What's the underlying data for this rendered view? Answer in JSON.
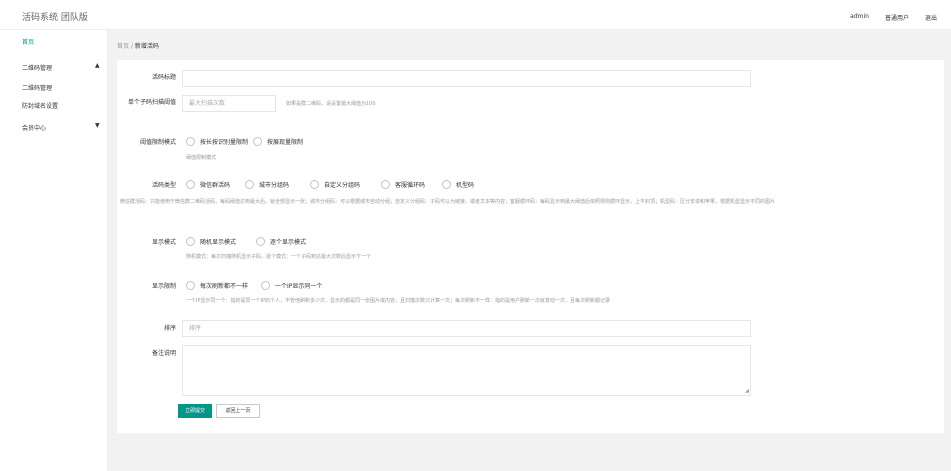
{
  "app": {
    "title": "活码系统 团队版"
  },
  "topnav": {
    "admin": "admin",
    "user_type": "普通用户",
    "logout": "退出"
  },
  "sidebar": {
    "items": [
      {
        "label": "首页",
        "caret": ""
      },
      {
        "label": "二维码管理",
        "caret": "▲"
      },
      {
        "label": "二维码管理",
        "caret": ""
      },
      {
        "label": "防封域名设置",
        "caret": ""
      },
      {
        "label": "会员中心",
        "caret": "▼"
      }
    ]
  },
  "breadcrumb": {
    "home": "首页",
    "sep": "/",
    "current": "新增活码"
  },
  "form": {
    "title_label": "活码标题",
    "title_value": "",
    "threshold_label": "单个子码扫描阈值",
    "threshold_placeholder": "最大扫描次数",
    "threshold_hint": "如果是群二维码，请设置最大阈值为100",
    "mode_label": "阈值限制模式",
    "mode_options": [
      "按长按识别量限制",
      "按展现量限制"
    ],
    "mode_hint": "阈值限制模式",
    "type_label": "活码类型",
    "type_options": [
      "微信群活码",
      "城市分组码",
      "自定义分组码",
      "客服循环码",
      "机型码"
    ],
    "type_hint": "微信群活码：只能使用于微信群二维码活码，每码阈值达到最大后，就全部显示一张；城市分组码：可以根据城市自动分组；自定义分组码：子码可以为链接，或者文本等内容；客服循环码：每码显示到最大阈值后依照规则循环显示，上不封顶；机型码：区分安卓和苹果，根据机型显示不同的图片",
    "display_label": "显示模式",
    "display_options": [
      "随机显示模式",
      "逐个显示模式"
    ],
    "display_hint": "随机模式：每次扫描随机显示子码，逐个模式：一个子码到达最大次数后显示下一个",
    "limit_label": "显示限制",
    "limit_options": [
      "每次刷新都不一样",
      "一个IP显示同一个"
    ],
    "limit_hint": "一个IP显示同一个：指的是同一个IP的个人，不管他刷新多少次，显示的都是同一张图片或内容，且扫描次数只计算一次；每次刷新不一样：指的是用户刷新一次就变动一次，且每次刷新都记录",
    "sort_label": "排序",
    "sort_placeholder": "排序",
    "remark_label": "备注说明",
    "submit": "立即提交",
    "back": "返回上一页"
  },
  "icons": {
    "dropdown_up": "caret-up-icon",
    "dropdown_down": "caret-down-icon",
    "radio": "radio-circle-icon",
    "resize": "resize-grip-icon"
  },
  "colors": {
    "accent": "#009688"
  }
}
